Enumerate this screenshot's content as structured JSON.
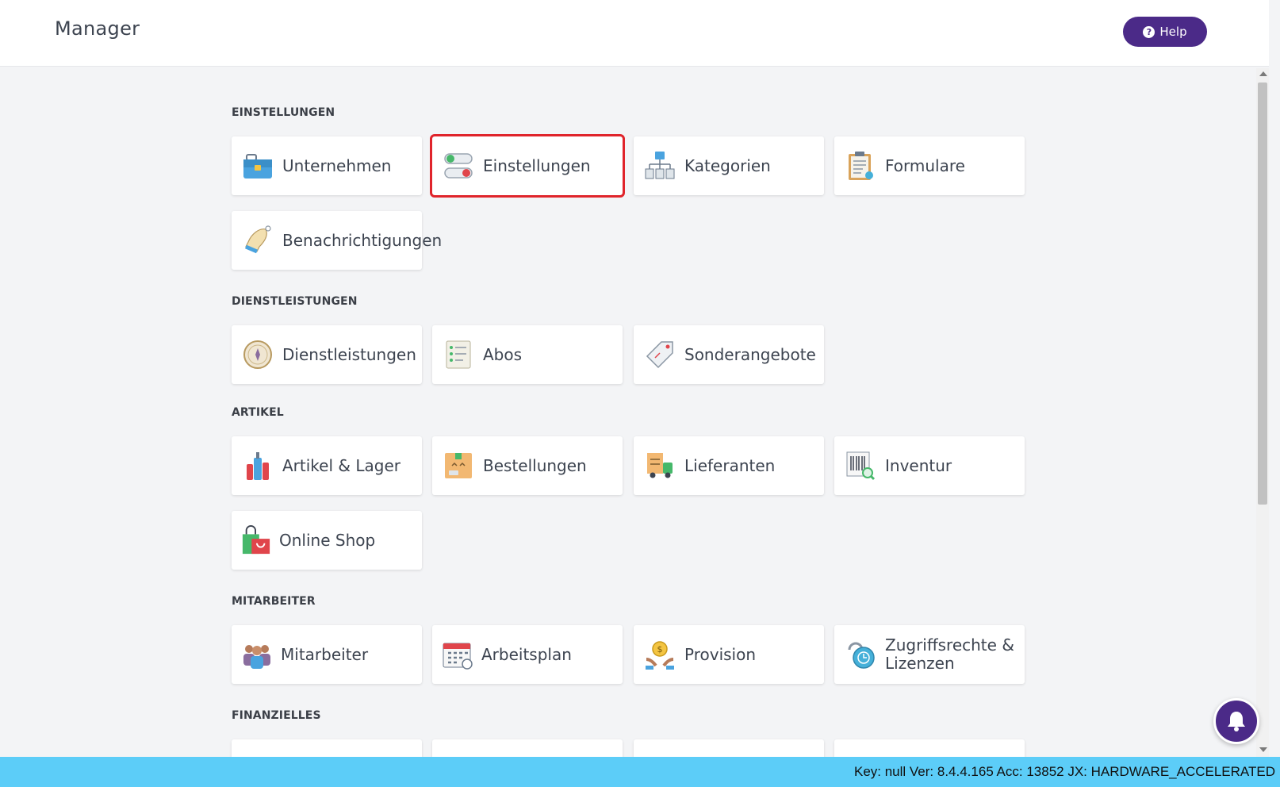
{
  "header": {
    "title": "Manager",
    "help_label": "Help"
  },
  "sections": [
    {
      "title": "EINSTELLUNGEN",
      "items": [
        {
          "label": "Unternehmen",
          "icon": "briefcase-icon"
        },
        {
          "label": "Einstellungen",
          "icon": "toggle-switches-icon",
          "selected": true
        },
        {
          "label": "Kategorien",
          "icon": "hierarchy-icon"
        },
        {
          "label": "Formulare",
          "icon": "clipboard-icon"
        },
        {
          "label": "Benachrichtigungen",
          "icon": "bell-icon"
        }
      ]
    },
    {
      "title": "DIENSTLEISTUNGEN",
      "items": [
        {
          "label": "Dienstleistungen",
          "icon": "compass-icon"
        },
        {
          "label": "Abos",
          "icon": "checklist-icon"
        },
        {
          "label": "Sonderangebote",
          "icon": "price-tag-icon"
        }
      ]
    },
    {
      "title": "ARTIKEL",
      "items": [
        {
          "label": "Artikel & Lager",
          "icon": "bottles-icon"
        },
        {
          "label": "Bestellungen",
          "icon": "package-icon"
        },
        {
          "label": "Lieferanten",
          "icon": "delivery-truck-icon"
        },
        {
          "label": "Inventur",
          "icon": "barcode-search-icon"
        },
        {
          "label": "Online Shop",
          "icon": "shopping-bags-icon"
        }
      ]
    },
    {
      "title": "MITARBEITER",
      "items": [
        {
          "label": "Mitarbeiter",
          "icon": "team-icon"
        },
        {
          "label": "Arbeitsplan",
          "icon": "calendar-icon"
        },
        {
          "label": "Provision",
          "icon": "coin-hands-icon"
        },
        {
          "label": "Zugriffsrechte & Lizenzen",
          "icon": "lock-icon"
        }
      ]
    },
    {
      "title": "FINANZIELLES",
      "items": []
    }
  ],
  "status": {
    "text": "Key: null Ver: 8.4.4.165 Acc: 13852  JX: HARDWARE_ACCELERATED"
  },
  "colors": {
    "accent": "#4b2a88",
    "status_bar": "#5ccdf8",
    "selection": "#e0242b"
  }
}
